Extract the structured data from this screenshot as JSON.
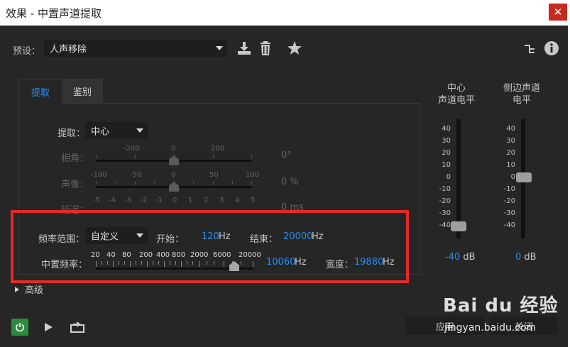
{
  "window": {
    "title": "效果 - 中置声道提取",
    "close_glyph": "✕"
  },
  "preset": {
    "label": "预设：",
    "value": "人声移除"
  },
  "tabs": [
    {
      "label": "提取"
    },
    {
      "label": "鉴别"
    }
  ],
  "extract": {
    "label": "提取：",
    "value": "中心"
  },
  "phase": {
    "label": "相角：",
    "scale": [
      "-200",
      "0",
      "200"
    ],
    "value": "0",
    "unit": "°"
  },
  "pan": {
    "label": "声像：",
    "scale": [
      "-100",
      "-50",
      "0",
      "50",
      "100"
    ],
    "value": "0",
    "unit": "%"
  },
  "delay": {
    "label": "延迟：",
    "scale": [
      "-5",
      "-4",
      "-3",
      "-2",
      "-1",
      "0",
      "1",
      "2",
      "3",
      "4",
      "5"
    ],
    "value": "0",
    "unit": "ms"
  },
  "freq_range": {
    "label": "频率范围：",
    "value": "自定义",
    "start_label": "开始：",
    "start_value": "120",
    "start_unit": "Hz",
    "end_label": "结束：",
    "end_value": "20000",
    "end_unit": "Hz"
  },
  "center_freq": {
    "label": "中置频率：",
    "scale": [
      "20",
      "40",
      "80",
      "200",
      "400",
      "800",
      "2000",
      "6000",
      "20000"
    ],
    "value": "10060",
    "unit": "Hz",
    "width_label": "宽度：",
    "width_value": "19880",
    "width_unit": "Hz"
  },
  "advanced": {
    "label": "高级"
  },
  "meters": {
    "scale": [
      "40",
      "30",
      "20",
      "10",
      "0",
      "-10",
      "-20",
      "-30",
      "-40"
    ],
    "center": {
      "title_line1": "中心",
      "title_line2": "声道电平",
      "value": "-40",
      "unit": "dB"
    },
    "side": {
      "title_line1": "侧边声道",
      "title_line2": "电平",
      "value": "0",
      "unit": "dB"
    }
  },
  "buttons": {
    "apply": "应用",
    "close": "关闭"
  },
  "watermark": {
    "text": "Bai du 经验",
    "url": "jingyan.baidu.com"
  },
  "colors": {
    "accent": "#2d8ceb",
    "panel": "#262626",
    "highlight_box": "#e32a2a",
    "power_on": "#2e8b3e"
  }
}
